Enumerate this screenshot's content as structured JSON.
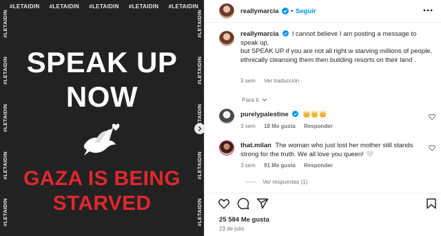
{
  "post": {
    "hashtag": "#LETAIDIN",
    "headline_line1": "SPEAK UP",
    "headline_line2": "NOW",
    "subline1": "GAZA IS BEING",
    "subline2": "STARVED"
  },
  "header": {
    "username": "reallymarcia",
    "separator": "•",
    "follow_label": "Seguir"
  },
  "caption": {
    "username": "reallymarcia",
    "line1": "I cannot believe I am posting a message to speak up,",
    "line2": "but SPEAK UP if you are not all right w starving millions of people, ethnically cleansing them then building resorts on their land .",
    "time": "3 sem",
    "translate_label": "Ver traducción"
  },
  "for_you_label": "Para ti",
  "comments": [
    {
      "username": "purelypalestine",
      "text": "👑👑👑",
      "time": "3 sem",
      "likes": "18 Me gusta",
      "reply_label": "Responder"
    },
    {
      "username": "that.milan",
      "text": "The woman who just lost her mother still stands strong for the truth. We all love you queen! 🤍",
      "time": "3 sem",
      "likes": "91 Me gusta",
      "reply_label": "Responder",
      "view_replies": "Ver respuestas (1)"
    }
  ],
  "footer": {
    "likes": "25 584 Me gusta",
    "date": "23 de julio"
  },
  "colors": {
    "accent": "#0095f6",
    "headline_red": "#e0282e",
    "image_bg": "#222222"
  }
}
